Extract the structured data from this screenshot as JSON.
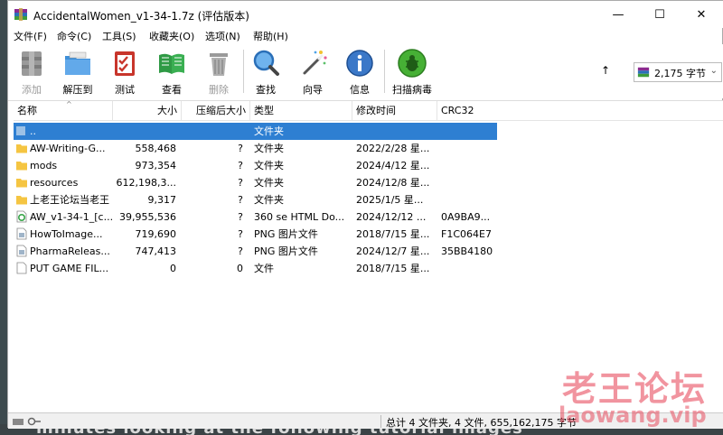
{
  "window": {
    "title": "AccidentalWomen_v1-34-1.7z (评估版本)",
    "minimize": "—",
    "maximize": "☐",
    "close": "✕"
  },
  "menu": [
    "文件(F)",
    "命令(C)",
    "工具(S)",
    "收藏夹(O)",
    "选项(N)",
    "帮助(H)"
  ],
  "toolbar": {
    "add": "添加",
    "extract": "解压到",
    "test": "测试",
    "view": "查看",
    "delete": "删除",
    "find": "查找",
    "wizard": "向导",
    "info": "信息",
    "scan": "扫描病毒"
  },
  "size_dropdown": {
    "value": "2,175 字节"
  },
  "columns": [
    "名称",
    "大小",
    "压缩后大小",
    "类型",
    "修改时间",
    "CRC32"
  ],
  "rows": [
    {
      "name": "..",
      "size": "",
      "packed": "",
      "type": "文件夹",
      "modified": "",
      "crc": "",
      "icon": "folder-up-icon"
    },
    {
      "name": "AW-Writing-G...",
      "size": "558,468",
      "packed": "?",
      "type": "文件夹",
      "modified": "2022/2/28 星...",
      "crc": "",
      "icon": "folder-icon"
    },
    {
      "name": "mods",
      "size": "973,354",
      "packed": "?",
      "type": "文件夹",
      "modified": "2024/4/12 星...",
      "crc": "",
      "icon": "folder-icon"
    },
    {
      "name": "resources",
      "size": "612,198,3...",
      "packed": "?",
      "type": "文件夹",
      "modified": "2024/12/8 星...",
      "crc": "",
      "icon": "folder-icon"
    },
    {
      "name": "上老王论坛当老王",
      "size": "9,317",
      "packed": "?",
      "type": "文件夹",
      "modified": "2025/1/5 星...",
      "crc": "",
      "icon": "folder-icon"
    },
    {
      "name": "AW_v1-34-1_[c...",
      "size": "39,955,536",
      "packed": "?",
      "type": "360 se HTML Do...",
      "modified": "2024/12/12 ...",
      "crc": "0A9BA9...",
      "icon": "html-file-icon"
    },
    {
      "name": "HowToImage...",
      "size": "719,690",
      "packed": "?",
      "type": "PNG 图片文件",
      "modified": "2018/7/15 星...",
      "crc": "F1C064E7",
      "icon": "image-file-icon"
    },
    {
      "name": "PharmaReleas...",
      "size": "747,413",
      "packed": "?",
      "type": "PNG 图片文件",
      "modified": "2024/12/7 星...",
      "crc": "35BB4180",
      "icon": "image-file-icon"
    },
    {
      "name": "PUT GAME FIL...",
      "size": "0",
      "packed": "0",
      "type": "文件",
      "modified": "2018/7/15 星...",
      "crc": "",
      "icon": "file-icon"
    }
  ],
  "status": {
    "text": "总计 4 文件夹, 4 文件, 655,162,175 字节"
  },
  "watermark": {
    "line1": "老王论坛",
    "line2": "laowang.vip"
  },
  "background_text": "minutes looking at the following tutorial images"
}
